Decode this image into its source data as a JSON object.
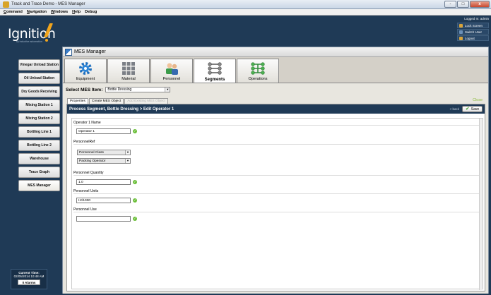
{
  "window": {
    "title": "Track and Trace Demo - MES Manager",
    "minimize": "-",
    "maximize": "□",
    "close": "x"
  },
  "menubar": [
    {
      "u": "C",
      "rest": "ommand"
    },
    {
      "u": "N",
      "rest": "avigation"
    },
    {
      "u": "W",
      "rest": "indows"
    },
    {
      "u": "H",
      "rest": "elp"
    },
    {
      "u": "",
      "rest": "Debug"
    }
  ],
  "logo": {
    "text": "Ignition",
    "subtitle": "by inductive automation"
  },
  "user": {
    "logged_in": "Logged In: admin",
    "buttons": [
      {
        "label": "Lock Screen",
        "color": "#d9a43a"
      },
      {
        "label": "Switch User",
        "color": "#6a8fb8"
      },
      {
        "label": "Logout",
        "color": "#d9a43a"
      }
    ]
  },
  "sidebar": {
    "items": [
      {
        "label": "Vinegar Unload Station"
      },
      {
        "label": "Oil Unload Station"
      },
      {
        "label": "Dry Goods Receiving"
      },
      {
        "label": "Mixing Station 1"
      },
      {
        "label": "Mixing Station 2"
      },
      {
        "label": "Bottling Line 1"
      },
      {
        "label": "Bottling Line 2"
      },
      {
        "label": "Warehouse"
      },
      {
        "label": "Trace Graph"
      },
      {
        "label": "MES Manager",
        "active": true
      }
    ],
    "time_label": "Current Time:",
    "time_value": "02/05/2014 10:48 AM",
    "alarms": "0 Alarms"
  },
  "main": {
    "title": "MES Manager",
    "tabs": [
      {
        "label": "Equipment",
        "icon": "gear-icon"
      },
      {
        "label": "Material",
        "icon": "grid-icon"
      },
      {
        "label": "Personnel",
        "icon": "people-icon"
      },
      {
        "label": "Segments",
        "icon": "segments-icon",
        "active": true
      },
      {
        "label": "Operations",
        "icon": "operations-icon"
      }
    ],
    "select_label": "Select MES Item:",
    "select_value": "Bottle Dressing",
    "subtabs": [
      {
        "label": "Properties",
        "active": true
      },
      {
        "label": "Create MES Object"
      },
      {
        "label": "Add Existing MES Object",
        "disabled": true
      }
    ],
    "close_link": "Close",
    "panel_title": "Process Segment, Bottle Dressing > Edit Operator 1",
    "back_link": "< back",
    "save_label": "Save",
    "form": {
      "name_label": "Operator 1 Name",
      "name_value": "Operator 1",
      "ref_label": "PersonnelRef",
      "ref_type": "Personnel Class",
      "ref_value": "Packing Operator",
      "qty_label": "Personnel Quantity",
      "qty_value": "1.0",
      "units_label": "Personnel Units",
      "units_value": "Hr/1000",
      "use_label": "Personnel Use",
      "use_value": ""
    }
  }
}
